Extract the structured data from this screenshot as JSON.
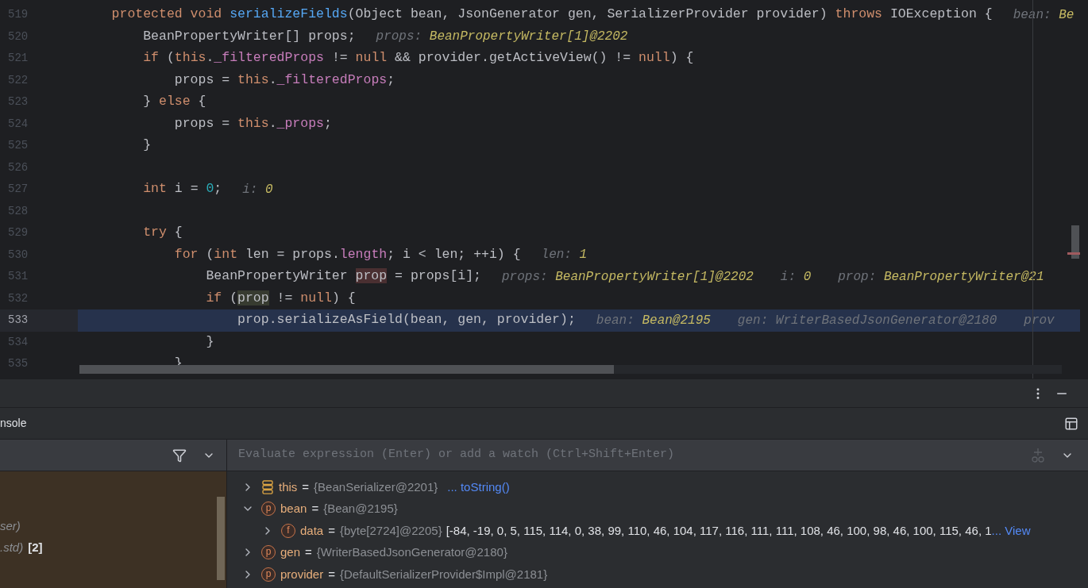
{
  "editor": {
    "lines": [
      {
        "number": "519",
        "current": false,
        "tokens": [
          {
            "kind": "keyword",
            "text": "    protected void "
          },
          {
            "kind": "method",
            "text": "serializeFields"
          },
          {
            "kind": "plain",
            "text": "(Object bean, JsonGenerator gen, SerializerProvider provider) "
          },
          {
            "kind": "keyword",
            "text": "throws"
          },
          {
            "kind": "plain",
            "text": " IOException {"
          }
        ],
        "hints": [
          {
            "name": "bean:",
            "value": "Be",
            "dimmed": false
          }
        ]
      },
      {
        "number": "520",
        "current": false,
        "tokens": [
          {
            "kind": "plain",
            "text": "        BeanPropertyWriter[] props;"
          }
        ],
        "hints": [
          {
            "name": "props:",
            "value": "BeanPropertyWriter[1]@2202",
            "dimmed": false
          }
        ]
      },
      {
        "number": "521",
        "current": false,
        "tokens": [
          {
            "kind": "keyword",
            "text": "        if"
          },
          {
            "kind": "plain",
            "text": " ("
          },
          {
            "kind": "keyword",
            "text": "this"
          },
          {
            "kind": "plain",
            "text": "."
          },
          {
            "kind": "field",
            "text": "_filteredProps"
          },
          {
            "kind": "plain",
            "text": " != "
          },
          {
            "kind": "keyword",
            "text": "null"
          },
          {
            "kind": "plain",
            "text": " && provider.getActiveView() != "
          },
          {
            "kind": "keyword",
            "text": "null"
          },
          {
            "kind": "plain",
            "text": ") {"
          }
        ]
      },
      {
        "number": "522",
        "current": false,
        "tokens": [
          {
            "kind": "plain",
            "text": "            props = "
          },
          {
            "kind": "keyword",
            "text": "this"
          },
          {
            "kind": "plain",
            "text": "."
          },
          {
            "kind": "field",
            "text": "_filteredProps"
          },
          {
            "kind": "plain",
            "text": ";"
          }
        ]
      },
      {
        "number": "523",
        "current": false,
        "tokens": [
          {
            "kind": "plain",
            "text": "        } "
          },
          {
            "kind": "keyword",
            "text": "else"
          },
          {
            "kind": "plain",
            "text": " {"
          }
        ]
      },
      {
        "number": "524",
        "current": false,
        "tokens": [
          {
            "kind": "plain",
            "text": "            props = "
          },
          {
            "kind": "keyword",
            "text": "this"
          },
          {
            "kind": "plain",
            "text": "."
          },
          {
            "kind": "field",
            "text": "_props"
          },
          {
            "kind": "plain",
            "text": ";"
          }
        ]
      },
      {
        "number": "525",
        "current": false,
        "tokens": [
          {
            "kind": "plain",
            "text": "        }"
          }
        ]
      },
      {
        "number": "526",
        "current": false
      },
      {
        "number": "527",
        "current": false,
        "tokens": [
          {
            "kind": "keyword",
            "text": "        int"
          },
          {
            "kind": "plain",
            "text": " i = "
          },
          {
            "kind": "number",
            "text": "0"
          },
          {
            "kind": "plain",
            "text": ";"
          }
        ],
        "hints": [
          {
            "name": "i:",
            "value": "0",
            "dimmed": false
          }
        ]
      },
      {
        "number": "528",
        "current": false
      },
      {
        "number": "529",
        "current": false,
        "tokens": [
          {
            "kind": "keyword",
            "text": "        try"
          },
          {
            "kind": "plain",
            "text": " {"
          }
        ]
      },
      {
        "number": "530",
        "current": false,
        "tokens": [
          {
            "kind": "keyword",
            "text": "            for"
          },
          {
            "kind": "plain",
            "text": " ("
          },
          {
            "kind": "keyword",
            "text": "int"
          },
          {
            "kind": "plain",
            "text": " len = props."
          },
          {
            "kind": "field",
            "text": "length"
          },
          {
            "kind": "plain",
            "text": "; i < len; ++i) {"
          }
        ],
        "hints": [
          {
            "name": "len:",
            "value": "1",
            "dimmed": false
          }
        ]
      },
      {
        "number": "531",
        "current": false,
        "tokens": [
          {
            "kind": "plain",
            "text": "                BeanPropertyWriter "
          },
          {
            "kind": "write",
            "text": "prop"
          },
          {
            "kind": "plain",
            "text": " = props[i];"
          }
        ],
        "hints": [
          {
            "name": "props:",
            "value": "BeanPropertyWriter[1]@2202",
            "dimmed": false
          },
          {
            "name": "i:",
            "value": "0",
            "dimmed": false
          },
          {
            "name": "prop:",
            "value": "BeanPropertyWriter@21",
            "dimmed": false
          }
        ]
      },
      {
        "number": "532",
        "current": false,
        "tokens": [
          {
            "kind": "keyword",
            "text": "                if"
          },
          {
            "kind": "plain",
            "text": " ("
          },
          {
            "kind": "read",
            "text": "prop"
          },
          {
            "kind": "plain",
            "text": " != "
          },
          {
            "kind": "keyword",
            "text": "null"
          },
          {
            "kind": "plain",
            "text": ") {"
          }
        ]
      },
      {
        "number": "533",
        "current": true,
        "tokens": [
          {
            "kind": "plain",
            "text": "                    prop.serializeAsField(bean, gen, provider);"
          }
        ],
        "hints": [
          {
            "name": "bean:",
            "value": "Bean@2195",
            "dimmed": false
          },
          {
            "name": "gen:",
            "value": "WriterBasedJsonGenerator@2180",
            "dimmed": true
          },
          {
            "name": "prov"
          }
        ]
      },
      {
        "number": "534",
        "current": false,
        "tokens": [
          {
            "kind": "plain",
            "text": "                }"
          }
        ]
      },
      {
        "number": "535",
        "current": false,
        "tokens": [
          {
            "kind": "plain",
            "text": "            }"
          }
        ]
      }
    ]
  },
  "panel": {
    "tab": "nsole",
    "frames": [
      {
        "text": "ser)"
      },
      {
        "text": ".std)",
        "count": "[2]"
      }
    ],
    "evaluate": {
      "placeholder": "Evaluate expression (Enter) or add a watch (Ctrl+Shift+Enter)"
    },
    "variables": [
      {
        "kind": "static",
        "name": "this",
        "operator": "=",
        "value": "{BeanSerializer@2201}",
        "expanded": false,
        "link": "... toString()"
      },
      {
        "kind": "param",
        "badge": "p",
        "name": "bean",
        "operator": "=",
        "value": "{Bean@2195}",
        "expanded": true,
        "children": [
          {
            "kind": "param",
            "badge": "f",
            "name": "data",
            "operator": "=",
            "value": "{byte[2724]@2205}",
            "expanded": false,
            "extra": "[-84, -19, 0, 5, 115, 114, 0, 38, 99, 110, 46, 104, 117, 116, 111, 111, 108, 46, 100, 98, 46, 100, 115, 46, 1",
            "link": "... View"
          }
        ]
      },
      {
        "kind": "param",
        "badge": "p",
        "name": "gen",
        "operator": "=",
        "value": "{WriterBasedJsonGenerator@2180}",
        "expanded": false
      },
      {
        "kind": "param",
        "badge": "p",
        "name": "provider",
        "operator": "=",
        "value": "{DefaultSerializerProvider$Impl@2181}",
        "expanded": false
      }
    ]
  }
}
